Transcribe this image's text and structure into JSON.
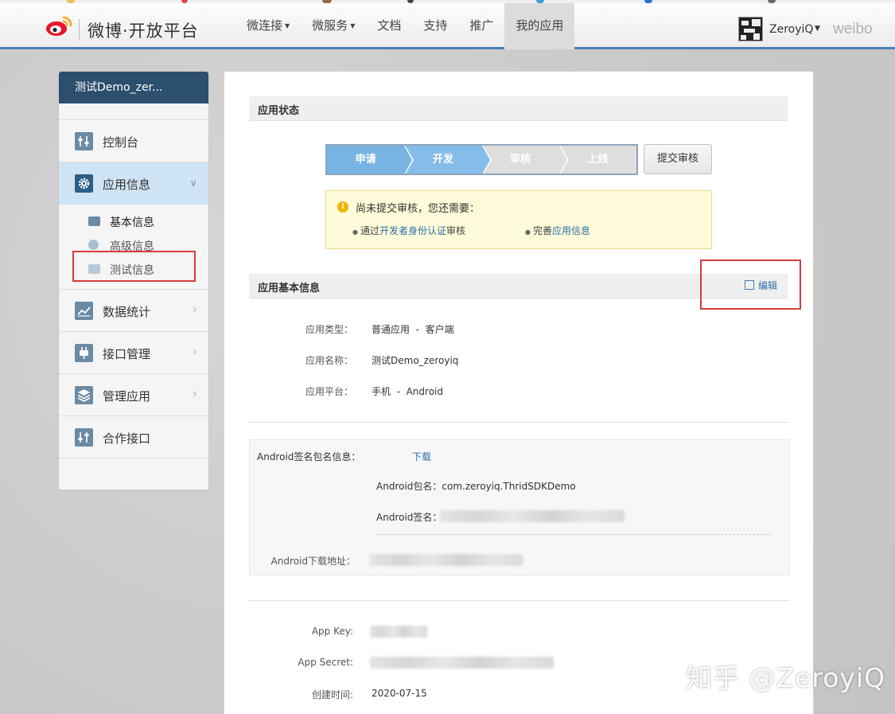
{
  "header": {
    "brand": "微博·开放平台",
    "nav": [
      {
        "label": "微连接",
        "dropdown": true
      },
      {
        "label": "微服务",
        "dropdown": true
      },
      {
        "label": "文档",
        "dropdown": false
      },
      {
        "label": "支持",
        "dropdown": false
      },
      {
        "label": "推广",
        "dropdown": false
      },
      {
        "label": "我的应用",
        "dropdown": false,
        "active": true
      }
    ],
    "user_name": "ZeroyiQ",
    "weibo_word": "weibo"
  },
  "sidebar": {
    "app_title": "测试Demo_zer...",
    "items": [
      {
        "label": "控制台",
        "icon": "console-icon"
      },
      {
        "label": "应用信息",
        "icon": "gear-icon",
        "expanded": true
      },
      {
        "label": "数据统计",
        "icon": "chart-icon"
      },
      {
        "label": "接口管理",
        "icon": "plug-icon"
      },
      {
        "label": "管理应用",
        "icon": "layers-icon"
      },
      {
        "label": "合作接口",
        "icon": "sliders-icon"
      }
    ],
    "sub_items": [
      {
        "label": "基本信息",
        "current": true
      },
      {
        "label": "高级信息"
      },
      {
        "label": "测试信息"
      }
    ]
  },
  "status": {
    "section_title": "应用状态",
    "steps": [
      {
        "label": "申请",
        "done": true
      },
      {
        "label": "开发",
        "done": true
      },
      {
        "label": "审核",
        "done": false
      },
      {
        "label": "上线",
        "done": false
      }
    ],
    "submit_label": "提交审核",
    "notice": {
      "message": "尚未提交审核，您还需要：",
      "req1_prefix": "通过",
      "req1_link": "开发者身份认证",
      "req1_suffix": "审核",
      "req2_prefix": "完善",
      "req2_link": "应用信息"
    }
  },
  "basic": {
    "section_title": "应用基本信息",
    "edit_label": "编辑",
    "rows": [
      {
        "label": "应用类型：",
        "value": "普通应用  -  客户端"
      },
      {
        "label": "应用名称：",
        "value": "测试Demo_zeroyiq"
      },
      {
        "label": "应用平台：",
        "value": "手机  -  Android"
      }
    ]
  },
  "android": {
    "sign_label": "Android签名包名信息：",
    "download_label": "下载",
    "package_label": "Android包名：",
    "package_value": "com.zeroyiq.ThridSDKDemo",
    "signature_label": "Android签名：",
    "download_url_label": "Android下载地址："
  },
  "keys": {
    "app_key_label": "App Key:",
    "app_secret_label": "App Secret:",
    "created_label": "创建时间:",
    "created_value": "2020-07-15"
  },
  "watermark": "知乎 @ZeroyiQ",
  "colors": {
    "header_accent": "#4a7fb6",
    "sidebar_title_bg": "#2c4f6e",
    "step_done": "#78b4e3",
    "link": "#2d6ea8",
    "annotation_red": "#d93a3a"
  }
}
